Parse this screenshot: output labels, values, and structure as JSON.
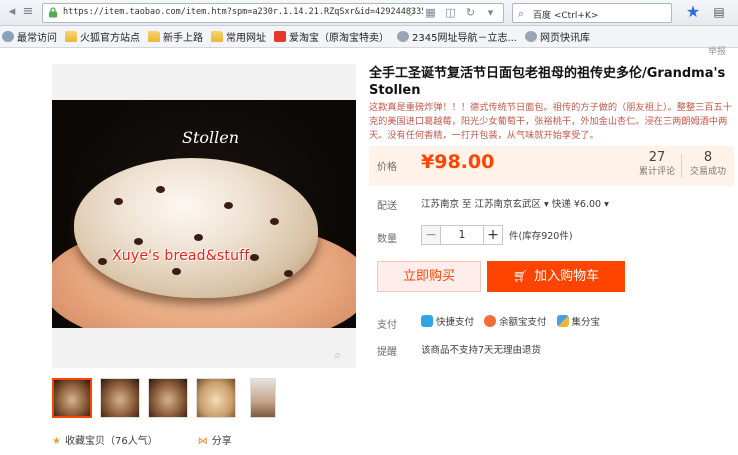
{
  "browser": {
    "url": "https://item.taobao.com/item.htm?spm=a230r.1.14.21.RZqSxr&id=42924483354&ns=1",
    "search_engine": "百度 <Ctrl+K>",
    "bookmarks": [
      {
        "label": "最常访问",
        "icon": "gear-icon"
      },
      {
        "label": "火狐官方站点",
        "icon": "folder-icon"
      },
      {
        "label": "新手上路",
        "icon": "folder-icon"
      },
      {
        "label": "常用网址",
        "icon": "folder-icon"
      },
      {
        "label": "爱淘宝（原淘宝特卖）",
        "icon": "taobao-icon"
      },
      {
        "label": "2345网址导航－立志...",
        "icon": "globe-icon"
      },
      {
        "label": "网页快讯库",
        "icon": "globe-icon"
      }
    ]
  },
  "page": {
    "corner_text": "举报",
    "gallery": {
      "photo_label": "Stollen",
      "watermark": "Xuye's bread&stuff"
    },
    "actions": {
      "favorite": "收藏宝贝（76人气）",
      "share": "分享"
    },
    "product": {
      "title": "全手工圣诞节复活节日面包老祖母的祖传史多伦/Grandma's Stollen",
      "description": "这款真是重磅炸弹！！！德式传统节日面包。祖传的方子做的（朋友祖上）。整整三百五十克的美国进口葛越莓，阳光少女葡萄干，张裕桃干，外加金山杏仁。浸在三两朗姆酒中两天。没有任何香精，一打开包装，从气味就开始享受了。",
      "price_label": "价格",
      "price": "¥98.00",
      "reviews_count": "27",
      "reviews_label": "累计评论",
      "sales_count": "8",
      "sales_label": "交易成功",
      "delivery_label": "配送",
      "delivery_text": "江苏南京 至 江苏南京玄武区 ▾   快递 ¥6.00 ▾",
      "qty_label": "数量",
      "qty_value": "1",
      "stock": "件(库存920件)",
      "buy_now": "立即购买",
      "add_cart": "加入购物车",
      "pay_label": "支付",
      "pay_methods": [
        "快捷支付",
        "余额宝支付",
        "集分宝"
      ],
      "remind_label": "提醒",
      "remind_text": "该商品不支持7天无理由退货"
    }
  },
  "colors": {
    "accent": "#ff4400",
    "price_bg": "#fff2e8"
  }
}
